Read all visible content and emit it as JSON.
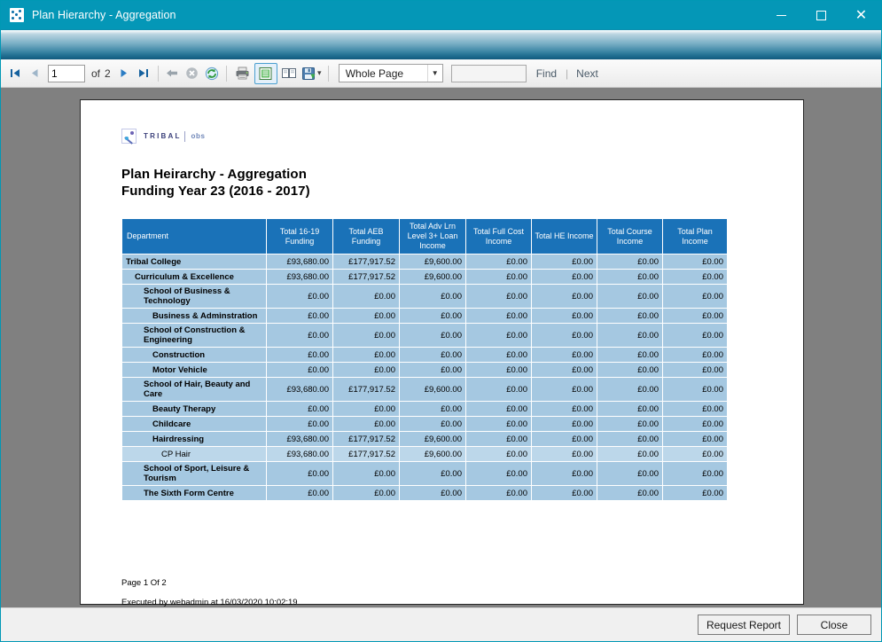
{
  "window": {
    "title": "Plan Hierarchy - Aggregation",
    "icon": "app-dots-icon",
    "minimize_label": "Minimize",
    "maximize_label": "Maximize",
    "close_label": "Close"
  },
  "toolbar": {
    "first_page_icon": "first-page-icon",
    "prev_page_icon": "previous-page-icon",
    "page_number": "1",
    "of_label": "of",
    "page_count": "2",
    "next_page_icon": "next-page-icon",
    "last_page_icon": "last-page-icon",
    "back_icon": "back-arrow-icon",
    "stop_icon": "stop-icon",
    "refresh_icon": "refresh-icon",
    "print_icon": "print-icon",
    "print_layout_icon": "print-layout-icon",
    "page_setup_icon": "page-setup-icon",
    "export_icon": "export-save-icon",
    "export_dropdown_icon": "chevron-down-icon",
    "zoom_value": "Whole Page",
    "zoom_dropdown_icon": "chevron-down-icon",
    "find_value": "",
    "find_placeholder": "",
    "find_label": "Find",
    "separator": "|",
    "next_label": "Next"
  },
  "report": {
    "logo": {
      "mark": "tribal-logo-icon",
      "word": "TRIBAL",
      "product": "obs",
      "superscript": "+"
    },
    "title_line1": "Plan Heirarchy - Aggregation",
    "title_line2": "Funding Year 23 (2016 - 2017)",
    "footer_page": "Page 1 Of 2",
    "footer_executed": "Executed by webadmin at 16/03/2020 10:02:19"
  },
  "table": {
    "columns": [
      "Department",
      "Total 16-19 Funding",
      "Total AEB Funding",
      "Total Adv Lrn Level 3+ Loan Income",
      "Total Full Cost Income",
      "Total HE Income",
      "Total Course Income",
      "Total Plan Income"
    ],
    "rows": [
      {
        "department": "Tribal College",
        "level": 0,
        "tall": false,
        "light": false,
        "values": [
          "£93,680.00",
          "£177,917.52",
          "£9,600.00",
          "£0.00",
          "£0.00",
          "£0.00",
          "£0.00"
        ]
      },
      {
        "department": "Curriculum & Excellence",
        "level": 1,
        "tall": false,
        "light": false,
        "values": [
          "£93,680.00",
          "£177,917.52",
          "£9,600.00",
          "£0.00",
          "£0.00",
          "£0.00",
          "£0.00"
        ]
      },
      {
        "department": "School of Business & Technology",
        "level": 2,
        "tall": true,
        "light": false,
        "values": [
          "£0.00",
          "£0.00",
          "£0.00",
          "£0.00",
          "£0.00",
          "£0.00",
          "£0.00"
        ]
      },
      {
        "department": "Business & Adminstration",
        "level": 3,
        "tall": false,
        "light": false,
        "values": [
          "£0.00",
          "£0.00",
          "£0.00",
          "£0.00",
          "£0.00",
          "£0.00",
          "£0.00"
        ]
      },
      {
        "department": "School of Construction & Engineering",
        "level": 2,
        "tall": true,
        "light": false,
        "values": [
          "£0.00",
          "£0.00",
          "£0.00",
          "£0.00",
          "£0.00",
          "£0.00",
          "£0.00"
        ]
      },
      {
        "department": "Construction",
        "level": 3,
        "tall": false,
        "light": false,
        "values": [
          "£0.00",
          "£0.00",
          "£0.00",
          "£0.00",
          "£0.00",
          "£0.00",
          "£0.00"
        ]
      },
      {
        "department": "Motor Vehicle",
        "level": 3,
        "tall": false,
        "light": false,
        "values": [
          "£0.00",
          "£0.00",
          "£0.00",
          "£0.00",
          "£0.00",
          "£0.00",
          "£0.00"
        ]
      },
      {
        "department": "School of Hair, Beauty and Care",
        "level": 2,
        "tall": false,
        "light": false,
        "values": [
          "£93,680.00",
          "£177,917.52",
          "£9,600.00",
          "£0.00",
          "£0.00",
          "£0.00",
          "£0.00"
        ]
      },
      {
        "department": "Beauty Therapy",
        "level": 3,
        "tall": false,
        "light": false,
        "values": [
          "£0.00",
          "£0.00",
          "£0.00",
          "£0.00",
          "£0.00",
          "£0.00",
          "£0.00"
        ]
      },
      {
        "department": "Childcare",
        "level": 3,
        "tall": false,
        "light": false,
        "values": [
          "£0.00",
          "£0.00",
          "£0.00",
          "£0.00",
          "£0.00",
          "£0.00",
          "£0.00"
        ]
      },
      {
        "department": "Hairdressing",
        "level": 3,
        "tall": false,
        "light": false,
        "values": [
          "£93,680.00",
          "£177,917.52",
          "£9,600.00",
          "£0.00",
          "£0.00",
          "£0.00",
          "£0.00"
        ]
      },
      {
        "department": "CP Hair",
        "level": 4,
        "tall": false,
        "light": true,
        "values": [
          "£93,680.00",
          "£177,917.52",
          "£9,600.00",
          "£0.00",
          "£0.00",
          "£0.00",
          "£0.00"
        ]
      },
      {
        "department": "School of Sport, Leisure & Tourism",
        "level": 2,
        "tall": true,
        "light": false,
        "values": [
          "£0.00",
          "£0.00",
          "£0.00",
          "£0.00",
          "£0.00",
          "£0.00",
          "£0.00"
        ]
      },
      {
        "department": "The Sixth Form Centre",
        "level": 2,
        "tall": false,
        "light": false,
        "values": [
          "£0.00",
          "£0.00",
          "£0.00",
          "£0.00",
          "£0.00",
          "£0.00",
          "£0.00"
        ]
      }
    ]
  },
  "footer_buttons": {
    "request_report": "Request Report",
    "close": "Close"
  },
  "colors": {
    "title_bar": "#0497b7",
    "table_header": "#1a72b8",
    "row_bg": "#a5c8e1",
    "row_bg_light": "#bcd7ea",
    "viewport_bg": "#808080"
  }
}
